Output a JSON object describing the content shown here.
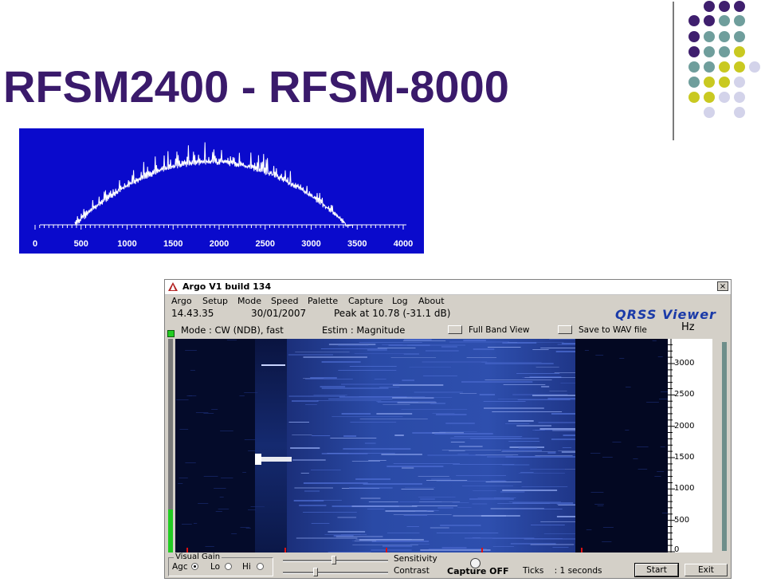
{
  "slide": {
    "title": "RFSM2400 - RFSM-8000"
  },
  "colors": {
    "title": "#3a1a6b",
    "dot_purple": "#3f1f6e",
    "dot_teal": "#6f9e9c",
    "dot_yellow": "#c9c921",
    "dot_lilac": "#d3d3ea",
    "spectrum_bg": "#0a0acc",
    "spectrogram_bg": "#000820"
  },
  "spectrum_plot": {
    "x_ticks": [
      "0",
      "500",
      "1000",
      "1500",
      "2000",
      "2500",
      "3000",
      "3500",
      "4000"
    ]
  },
  "argo": {
    "title": "Argo V1 build 134",
    "close_label": "×",
    "menu": [
      "Argo",
      "Setup",
      "Mode",
      "Speed",
      "Palette",
      "Capture",
      "Log",
      "About"
    ],
    "time": "14.43.35",
    "date": "30/01/2007",
    "peak": "Peak at  10.78 (-31.1 dB)",
    "brand": "QRSS Viewer",
    "mode": "Mode : CW (NDB), fast",
    "estim": "Estim : Magnitude",
    "full_band_label": "Full Band View",
    "save_wav_label": "Save to WAV file",
    "hz_unit": "Hz",
    "freq_ticks": [
      "3000",
      "2500",
      "2000",
      "1500",
      "1000",
      "500",
      "0"
    ],
    "visual_gain_label": "Visual Gain",
    "agc_label": "Agc",
    "lo_label": "Lo",
    "hi_label": "Hi",
    "sensitivity_label": "Sensitivity",
    "contrast_label": "Contrast",
    "capture_status": "Capture OFF",
    "ticks_text": "Ticks    : 1 seconds",
    "start_label": "Start",
    "exit_label": "Exit",
    "gain_mode_selected": "Agc",
    "input_level_fraction": 0.2
  }
}
